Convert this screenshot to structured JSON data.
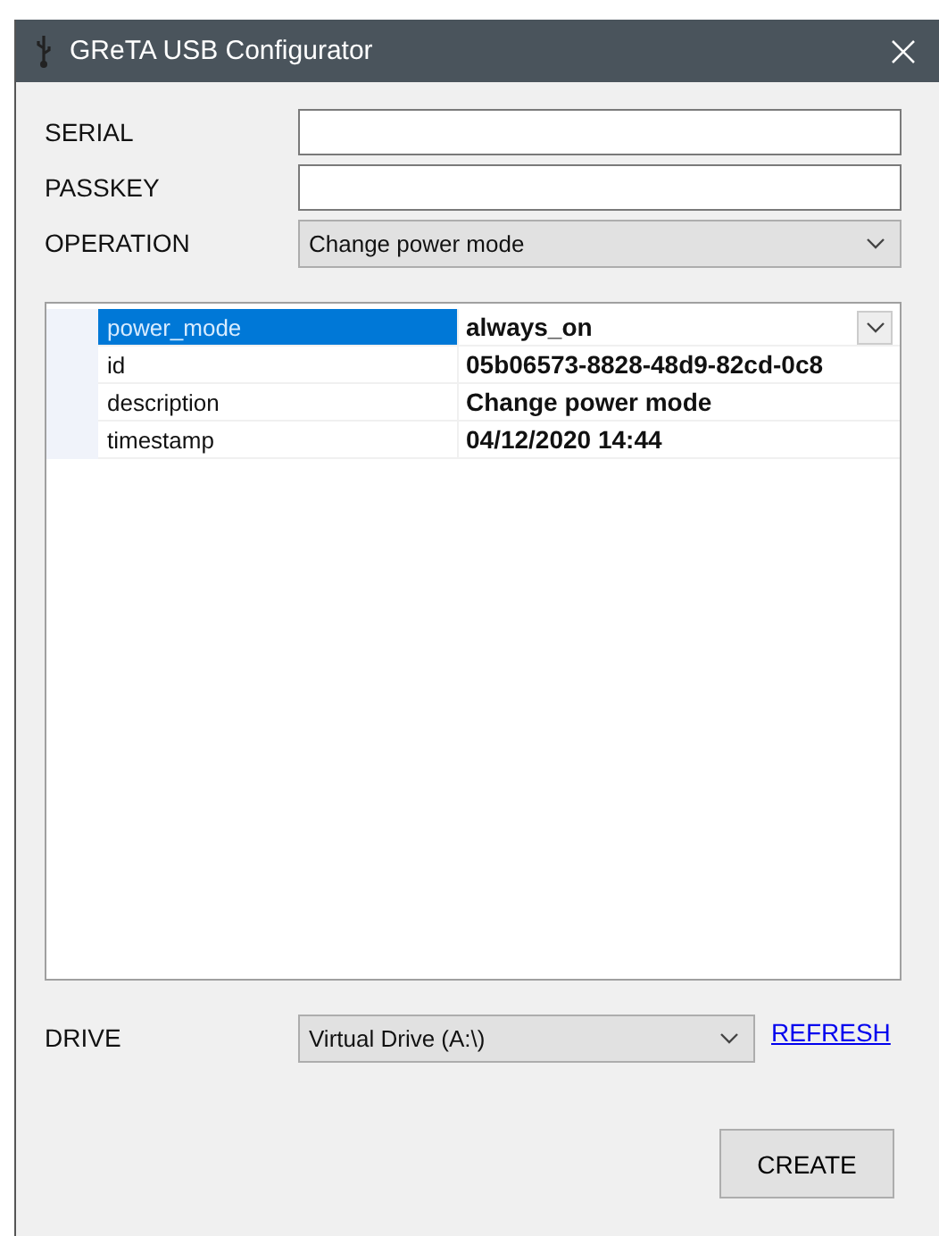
{
  "window": {
    "title": "GReTA USB Configurator"
  },
  "fields": [
    {
      "label": "SERIAL",
      "kind": "text"
    },
    {
      "label": "PASSKEY",
      "kind": "text"
    },
    {
      "label": "OPERATION",
      "kind": "dropdown",
      "value": "Change power mode"
    }
  ],
  "properties": [
    {
      "name": "power_mode",
      "value": "always_on",
      "selected": true,
      "kind": "dropdown"
    },
    {
      "name": "id",
      "value": "05b06573-8828-48d9-82cd-0c8",
      "selected": false,
      "kind": "text"
    },
    {
      "name": "description",
      "value": "Change power mode",
      "selected": false,
      "kind": "text"
    },
    {
      "name": "timestamp",
      "value": "04/12/2020 14:44",
      "selected": false,
      "kind": "text"
    }
  ],
  "drive": {
    "label": "DRIVE",
    "value": "Virtual Drive (A:\\)",
    "link": "REFRESH"
  },
  "buttons": [
    "CREATE"
  ]
}
